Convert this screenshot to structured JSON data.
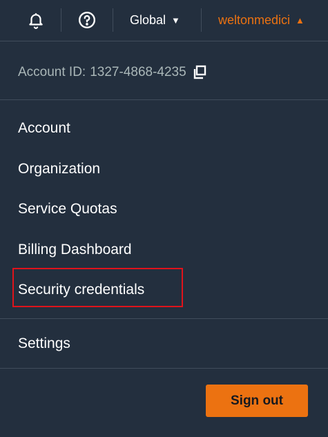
{
  "topbar": {
    "notifications_icon": "bell-icon",
    "help_icon": "help-circle-icon",
    "region_label": "Global",
    "username": "weltonmedici",
    "user_accent_color": "#ec7211"
  },
  "account": {
    "id_label": "Account ID:",
    "id_value": "1327-4868-4235",
    "copy_icon": "copy-icon"
  },
  "menu": {
    "items": [
      {
        "label": "Account"
      },
      {
        "label": "Organization"
      },
      {
        "label": "Service Quotas"
      },
      {
        "label": "Billing Dashboard"
      },
      {
        "label": "Security credentials",
        "highlighted": true
      },
      {
        "label": "Settings"
      }
    ]
  },
  "signout": {
    "label": "Sign out",
    "color": "#ec7211"
  }
}
